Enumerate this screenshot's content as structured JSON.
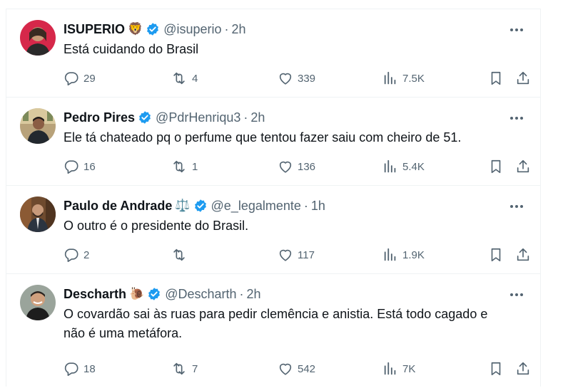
{
  "tweets": [
    {
      "name": "ISUPERIO",
      "badge_emoji": "🦁",
      "handle": "@isuperio",
      "sep": "·",
      "time": "2h",
      "text_lines": [
        "Está cuidando do Brasil"
      ],
      "replies": "29",
      "reposts": "4",
      "likes": "339",
      "views": "7.5K"
    },
    {
      "name": "Pedro Pires",
      "badge_emoji": "",
      "handle": "@PdrHenriqu3",
      "sep": "·",
      "time": "2h",
      "text_lines": [
        "Ele tá chateado pq o perfume que tentou fazer saiu com cheiro de 51."
      ],
      "replies": "16",
      "reposts": "1",
      "likes": "136",
      "views": "5.4K"
    },
    {
      "name": "Paulo de Andrade",
      "badge_emoji": "⚖️",
      "handle": "@e_legalmente",
      "sep": "·",
      "time": "1h",
      "text_lines": [
        "O outro é o presidente do Brasil."
      ],
      "replies": "2",
      "reposts": "",
      "likes": "117",
      "views": "1.9K"
    },
    {
      "name": "Descharth",
      "badge_emoji": "🐌",
      "handle": "@Descharth",
      "sep": "·",
      "time": "2h",
      "text_lines": [
        "O covardão sai às ruas para pedir clemência e anistia. Está todo cagado e",
        "não é uma metáfora."
      ],
      "replies": "18",
      "reposts": "7",
      "likes": "542",
      "views": "7K"
    }
  ],
  "icons": {
    "reply": "reply-icon",
    "repost": "repost-icon",
    "like": "heart-icon",
    "views": "views-icon",
    "bookmark": "bookmark-icon",
    "share": "share-icon",
    "more": "more-icon",
    "verified": "verified-badge-icon"
  },
  "colors": {
    "verified": "#1d9bf0",
    "text": "#0f1419",
    "muted": "#536471",
    "divider": "#eff3f4"
  }
}
